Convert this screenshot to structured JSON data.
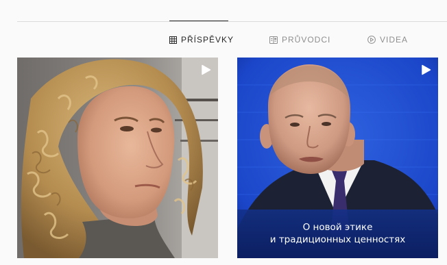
{
  "tabs": [
    {
      "label": "PŘÍSPĚVKY",
      "icon": "grid-icon",
      "active": true
    },
    {
      "label": "PRŮVODCI",
      "icon": "guide-icon",
      "active": false
    },
    {
      "label": "VIDEA",
      "icon": "play-circle-icon",
      "active": false
    }
  ],
  "posts": [
    {
      "type": "video",
      "icon": "video-play-icon",
      "caption_lines": []
    },
    {
      "type": "video",
      "icon": "video-play-icon",
      "caption_lines": [
        "О новой этике",
        "и традиционных ценностях"
      ]
    }
  ],
  "colors": {
    "background": "#fafafa",
    "active_tab": "#262626",
    "inactive_tab": "#8e8e8e",
    "divider": "#dbdbdb",
    "studio_blue": "#1b46c9"
  }
}
